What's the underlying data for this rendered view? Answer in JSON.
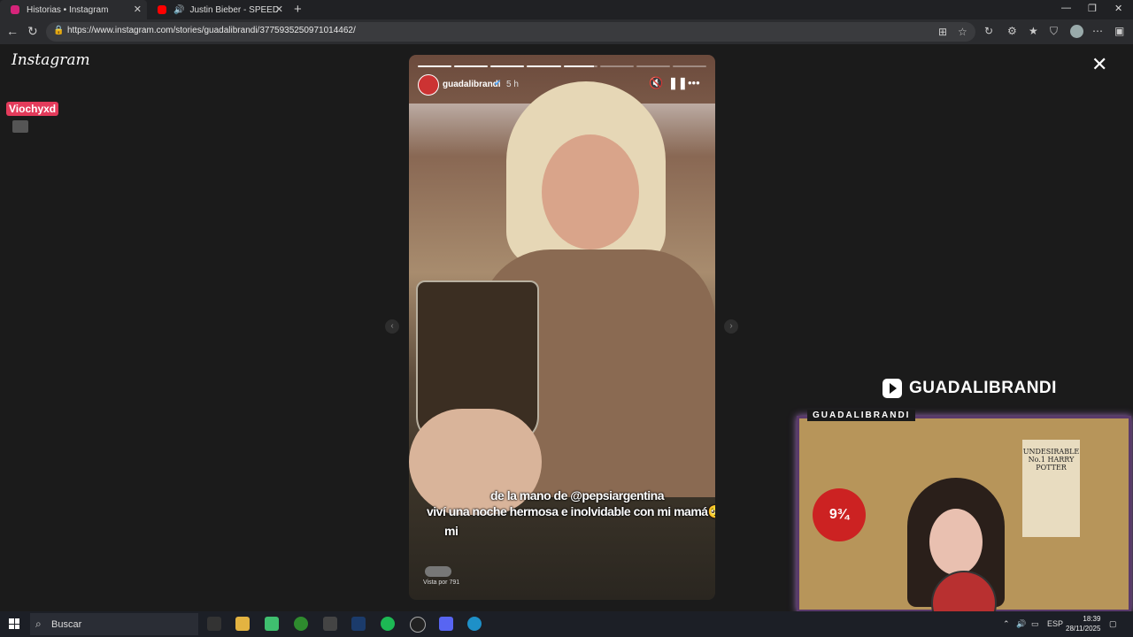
{
  "browser": {
    "tabs": [
      {
        "title": "Historias • Instagram",
        "active": true,
        "favicon_color": "#d6247a"
      },
      {
        "title": "Justin Bieber - SPEED DEMON",
        "active": false,
        "favicon_color": "#ff0000"
      }
    ],
    "url": "https://www.instagram.com/stories/guadalibrandi/3775935250971014462/"
  },
  "instagram": {
    "logo": "Instagram",
    "sticker": "Viochyxd",
    "story": {
      "username": "guadalibrandi",
      "verified_icon": "✔",
      "time_ago": "5 h",
      "progress_segments": 8,
      "caption_line1": "de la mano de @pepsiargentina",
      "caption_line2": "viví una noche hermosa e inolvidable con mi mamá🥺💖",
      "caption_line3": "mi",
      "viewed_by": "Vista por 791"
    }
  },
  "stream_overlay": {
    "channel": "GUADALIBRANDI",
    "cam_title": "GUADALIBRANDI",
    "poster_text": "UNDESIRABLE No.1 HARRY POTTER",
    "platform_sign": "9¾"
  },
  "taskbar": {
    "search_placeholder": "Buscar",
    "language": "ESP",
    "time": "18:39",
    "date": "28/11/2025"
  }
}
